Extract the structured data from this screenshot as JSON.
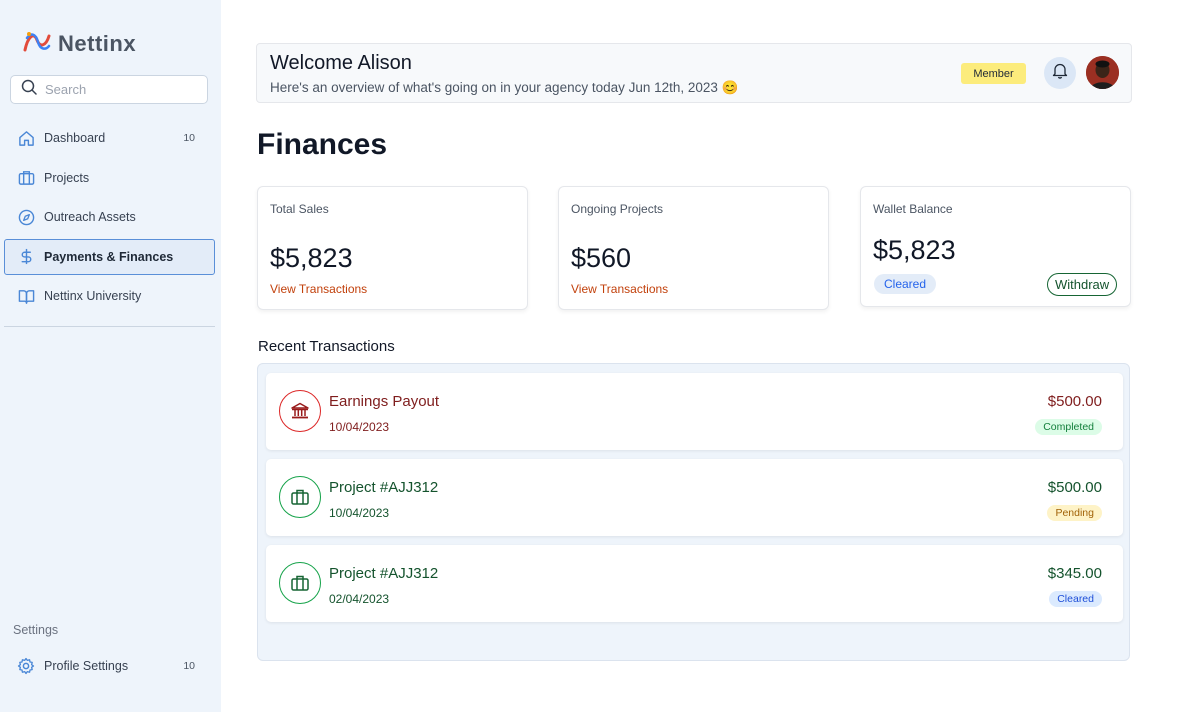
{
  "brand": {
    "name": "Nettinx"
  },
  "search": {
    "placeholder": "Search"
  },
  "sidebar": {
    "items": [
      {
        "label": "Dashboard",
        "count": "10",
        "icon": "home-icon"
      },
      {
        "label": "Projects",
        "icon": "briefcase-icon"
      },
      {
        "label": "Outreach Assets",
        "icon": "compass-icon"
      },
      {
        "label": "Payments & Finances",
        "icon": "dollar-icon",
        "active": true
      },
      {
        "label": "Nettinx University",
        "icon": "book-icon"
      }
    ],
    "settings_label": "Settings",
    "profile": {
      "label": "Profile Settings",
      "count": "10",
      "icon": "gear-icon"
    }
  },
  "header": {
    "welcome": "Welcome Alison",
    "overview": "Here's an overview of what's going on in your agency today Jun 12th, 2023 😊",
    "badge": "Member"
  },
  "page": {
    "title": "Finances"
  },
  "cards": {
    "total_sales": {
      "label": "Total Sales",
      "value": "$5,823",
      "link": "View Transactions"
    },
    "ongoing": {
      "label": "Ongoing Projects",
      "value": "$560",
      "link": "View Transactions"
    },
    "wallet": {
      "label": "Wallet Balance",
      "value": "$5,823",
      "status": "Cleared",
      "action": "Withdraw"
    }
  },
  "transactions": {
    "title": "Recent Transactions",
    "rows": [
      {
        "title": "Earnings Payout",
        "date": "10/04/2023",
        "amount": "$500.00",
        "status": "Completed",
        "icon": "bank-icon"
      },
      {
        "title": "Project #AJJ312",
        "date": "10/04/2023",
        "amount": "$500.00",
        "status": "Pending",
        "icon": "briefcase-icon"
      },
      {
        "title": "Project #AJJ312",
        "date": "02/04/2023",
        "amount": "$345.00",
        "status": "Cleared",
        "icon": "briefcase-icon"
      }
    ]
  },
  "colors": {
    "accent": "#5a8fd8",
    "link": "#c2410c",
    "member": "#fcec7c"
  }
}
